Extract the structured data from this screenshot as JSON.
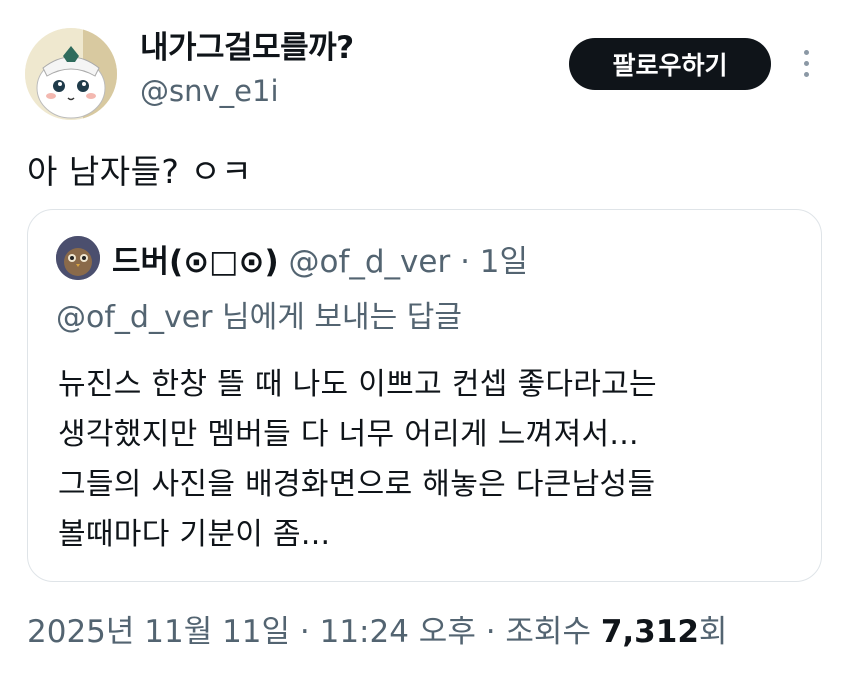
{
  "author": {
    "display_name": "내가그걸모를까?",
    "handle": "@snv_e1i"
  },
  "follow_button": {
    "label": "팔로우하기"
  },
  "more_menu": {
    "icon": "more-vertical-icon"
  },
  "tweet": {
    "text": "아 남자들? ㅇㅋ"
  },
  "quote": {
    "display_name": "드버(⊙□⊙)",
    "handle": "@of_d_ver",
    "separator": "·",
    "time": "1일",
    "reply_mention": "@of_d_ver",
    "reply_suffix": " 님에게 보내는 답글",
    "body_lines": [
      "뉴진스 한창 뜰 때 나도 이쁘고 컨셉 좋다라고는",
      "생각했지만 멤버들 다 너무 어리게 느껴져서...",
      "그들의 사진을 배경화면으로 해놓은 다큰남성들",
      "볼때마다 기분이 좀..."
    ]
  },
  "footer": {
    "datetime": "2025년 11월 11일 · 11:24 오후 · 조회수 ",
    "views_count": "7,312",
    "views_suffix": "회"
  },
  "colors": {
    "text": "#0f1419",
    "secondary": "#536471",
    "button_bg": "#0f1419",
    "border": "#dfe4e8"
  }
}
